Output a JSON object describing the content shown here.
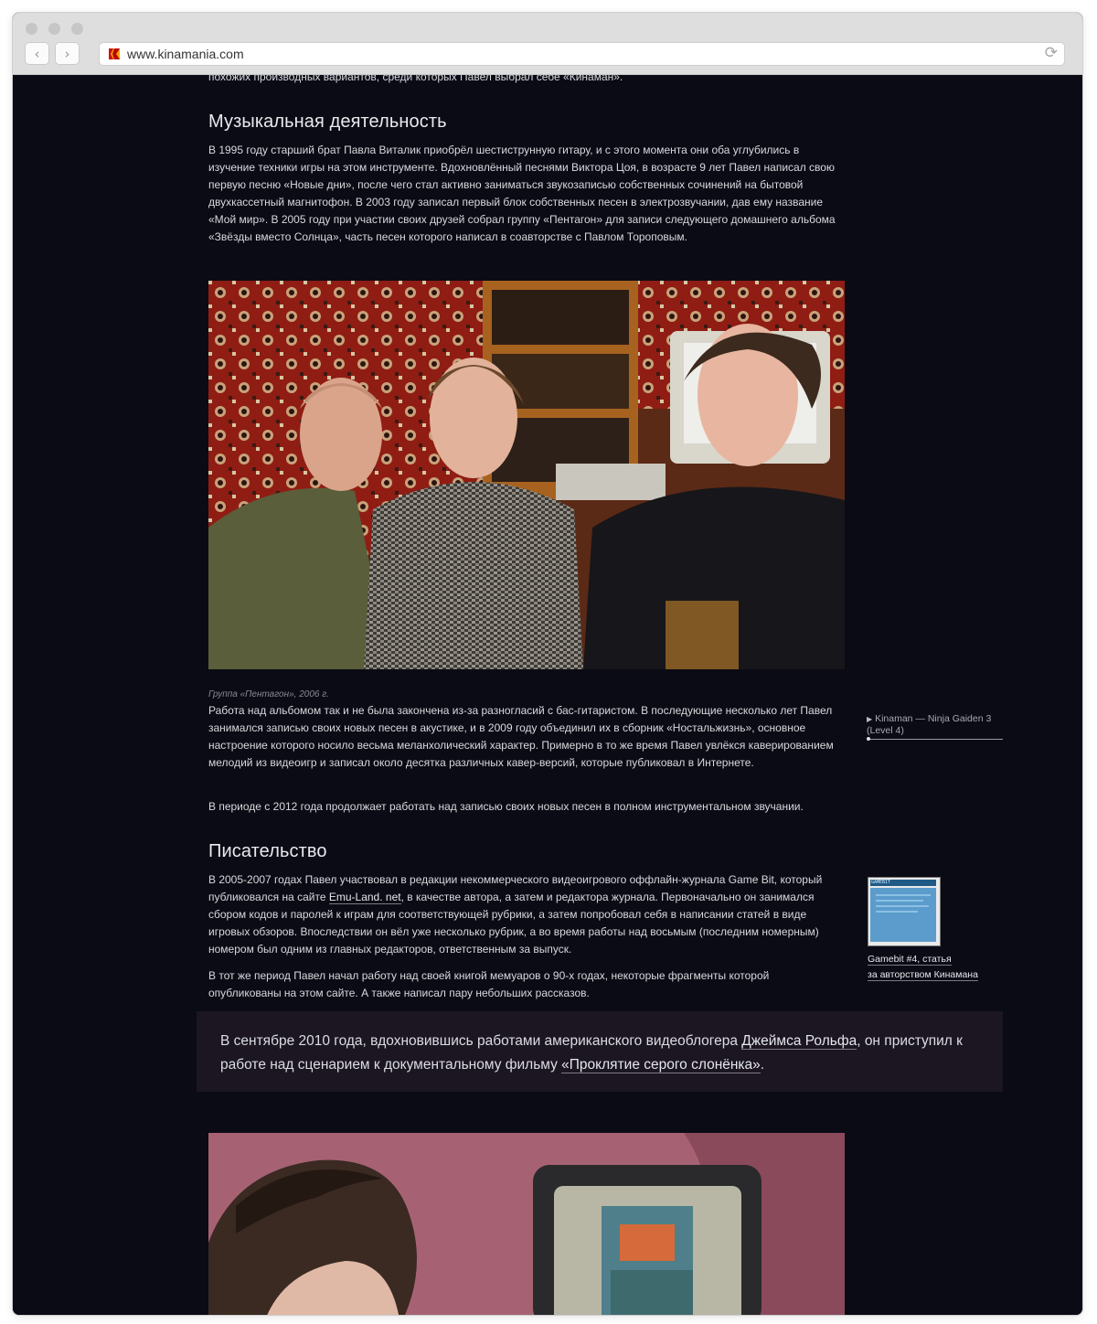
{
  "browser": {
    "url": "www.kinamania.com"
  },
  "article": {
    "top_fragment": "похожих производных вариантов, среди которых Павел выбрал себе «Кинаман».",
    "music_heading": "Музыкальная деятельность",
    "music_paragraph": "В 1995 году старший брат Павла Виталик приобрёл шестиструнную гитару, и с этого момента они оба углубились в изучение техники игры на этом инструменте. Вдохновлённый песнями Виктора Цоя, в возрасте 9 лет Павел написал свою первую песню «Новые дни», после чего стал активно заниматься звукозаписью собственных сочинений на бытовой двухкассетный магнитофон. В 2003 году записал первый блок собственных песен в электрозвучании, дав ему название «Мой мир». В 2005 году при участии своих друзей собрал группу «Пентагон» для записи следующего домашнего альбома «Звёзды вместо Солнца», часть песен которого написал в соавторстве с Павлом Тороповым.",
    "photo1_caption": "Группа «Пентагон», 2006 г.",
    "paragraph2": "Работа над альбомом так и не была закончена из-за разногласий с бас-гитаристом. В последующие несколько лет Павел занимался записью своих новых песен в акустике, и в 2009 году объединил их в сборник «Ностальжизнь», основное настроение которого носило весьма меланхолический характер. Примерно в то же время Павел увлёкся каверированием мелодий из видеоигр и записал около десятка различных кавер-версий, которые публиковал в Интернете.",
    "paragraph3": "В периоде с 2012 года продолжает работать над записью своих новых песен в полном инструментальном звучании.",
    "writing_heading": "Писательство",
    "writing_p1_before": "В 2005-2007 годах Павел участвовал в редакции некоммерческого видеоигрового оффлайн-журнала Game Bit, который публиковался на сайте ",
    "writing_p1_link": "Emu-Land. net",
    "writing_p1_after": ", в качестве автора, а затем и редактора журнала. Первоначально он занимался сбором кодов и паролей к играм для соответствующей рубрики, а затем попробовал себя в написании статей в виде игровых обзоров. Впоследствии он вёл уже несколько рубрик, а во время работы над восьмым (последним номерным) номером был одним из главных редакторов, ответственным за выпуск.",
    "writing_p2": "В тот же период Павел начал работу над своей книгой мемуаров о 90-х годах, некоторые фрагменты которой опубликованы на этом сайте. А также написал пару небольших рассказов.",
    "quote_before": "В сентябре 2010 года, вдохновившись работами американского видеоблогера ",
    "quote_link1": "Джеймса Рольфа",
    "quote_middle": ", он приступил к работе над сценарием к документальному фильму ",
    "quote_link2": "«Проклятие серого слонёнка»",
    "quote_end": "."
  },
  "sidebar": {
    "audio_title": "Kinaman — Ninja Gaiden 3 (Level 4)",
    "audio_progress": 0,
    "gamebit_caption_line1": "Gamebit #4, статья",
    "gamebit_caption_line2": "за авторством Кинамана",
    "gamebit_thumb_label": "GAMEBIT"
  },
  "colors": {
    "page_bg": "#0b0b15",
    "quote_bg": "#1b1622",
    "text": "#d8d8de",
    "caption": "#8a8a95"
  }
}
